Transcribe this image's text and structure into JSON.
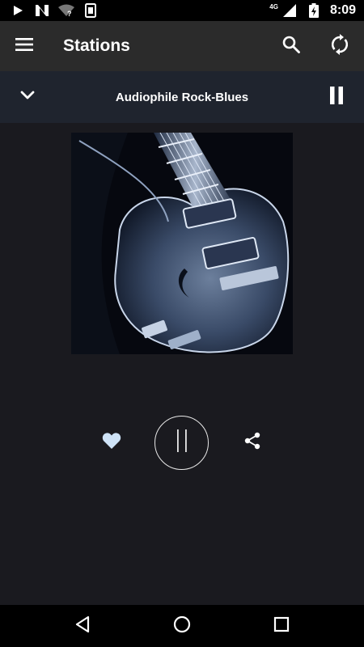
{
  "status_bar": {
    "time": "8:09",
    "network_label": "4G",
    "icons": [
      "play-store-icon",
      "n-notification-icon",
      "wifi-unknown-icon",
      "sim-card-icon",
      "signal-icon",
      "battery-charging-icon"
    ]
  },
  "toolbar": {
    "title": "Stations",
    "icons": [
      "menu-icon",
      "search-icon",
      "refresh-icon"
    ]
  },
  "now_playing": {
    "station_name": "Audiophile Rock-Blues",
    "icons": [
      "chevron-down-icon",
      "pause-icon"
    ]
  },
  "artwork": {
    "subject": "guitar-artwork"
  },
  "controls": {
    "icons": [
      "heart-icon",
      "pause-icon",
      "share-icon"
    ],
    "colors": {
      "heart": "#cfe3f7",
      "ring": "#e8e8e8"
    }
  },
  "nav_bar": {
    "icons": [
      "back-icon",
      "home-icon",
      "recents-icon"
    ]
  },
  "colors": {
    "background": "#1a1a1f",
    "toolbar": "#2b2b2b",
    "now_playing_bar": "#1f242e",
    "status_bar": "#000000"
  }
}
